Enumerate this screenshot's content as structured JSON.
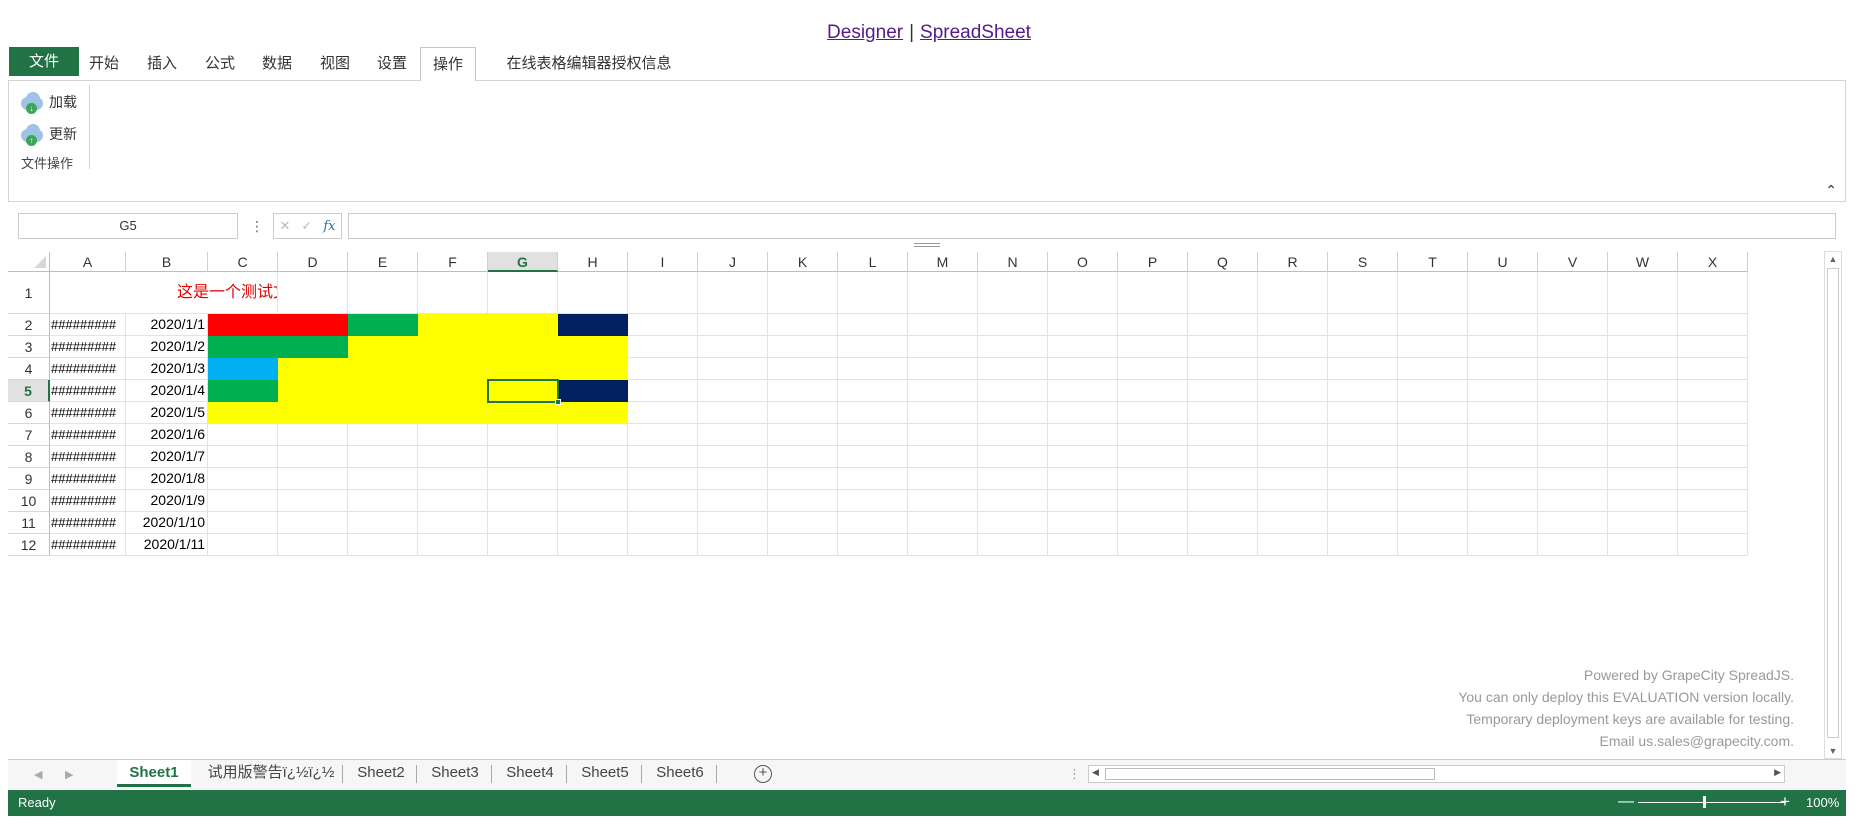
{
  "toplinks": {
    "designer": "Designer",
    "separator": "|",
    "spreadsheet": "SpreadSheet"
  },
  "ribbon": {
    "tabs": [
      "文件",
      "开始",
      "插入",
      "公式",
      "数据",
      "视图",
      "设置",
      "操作",
      "在线表格编辑器授权信息"
    ],
    "active_tab": "操作",
    "buttons": {
      "load": "加载",
      "update": "更新"
    },
    "group_label": "文件操作",
    "collapse_icon": "^"
  },
  "formula_bar": {
    "name_box": "G5",
    "menu_dots": "⋮",
    "cancel": "✕",
    "confirm": "✓",
    "fx": "fx",
    "formula": ""
  },
  "grid": {
    "columns": [
      "A",
      "B",
      "C",
      "D",
      "E",
      "F",
      "G",
      "H",
      "I",
      "J",
      "K",
      "L",
      "M",
      "N",
      "O",
      "P",
      "Q",
      "R",
      "S",
      "T",
      "U",
      "V",
      "W",
      "X"
    ],
    "selected_column": "G",
    "selected_row": "5",
    "rows": [
      "1",
      "2",
      "3",
      "4",
      "5",
      "6",
      "7",
      "8",
      "9",
      "10",
      "11",
      "12"
    ],
    "title_text": "这是一个测试文件",
    "col_a_values": [
      "#########",
      "#########",
      "#########",
      "#########",
      "#########",
      "#########",
      "#########",
      "#########",
      "#########",
      "#########",
      "#########"
    ],
    "col_b_values": [
      "2020/1/1",
      "2020/1/2",
      "2020/1/3",
      "2020/1/4",
      "2020/1/5",
      "2020/1/6",
      "2020/1/7",
      "2020/1/8",
      "2020/1/9",
      "2020/1/10",
      "2020/1/11"
    ],
    "colors": {
      "red": "#ff0000",
      "green": "#00b050",
      "yellow": "#ffff00",
      "navy": "#002060",
      "lightblue": "#00b0f0",
      "accent": "#217346"
    }
  },
  "watermark": [
    "Powered by GrapeCity SpreadJS.",
    "You can only deploy this EVALUATION version locally.",
    "Temporary deployment keys are available for testing.",
    "Email us.sales@grapecity.com."
  ],
  "sheet_tabs": {
    "tabs": [
      "Sheet1",
      "试用版警告ï¿½ï¿½",
      "Sheet2",
      "Sheet3",
      "Sheet4",
      "Sheet5",
      "Sheet6"
    ],
    "active": "Sheet1"
  },
  "status_bar": {
    "ready": "Ready",
    "zoom_minus": "—",
    "zoom_plus": "+",
    "zoom": "100%",
    "zoom_percent": 100
  }
}
